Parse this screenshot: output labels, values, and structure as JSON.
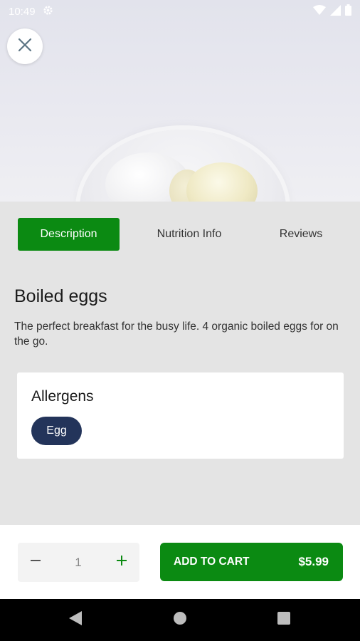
{
  "status_bar": {
    "time": "10:49"
  },
  "tabs": [
    {
      "label": "Description",
      "active": true
    },
    {
      "label": "Nutrition Info",
      "active": false
    },
    {
      "label": "Reviews",
      "active": false
    }
  ],
  "product": {
    "title": "Boiled eggs",
    "description": "The perfect breakfast for the busy life. 4 organic boiled eggs for on the go."
  },
  "allergens": {
    "heading": "Allergens",
    "items": [
      "Egg"
    ]
  },
  "quantity": {
    "value": "1",
    "decrement_icon": "minus-icon",
    "increment_icon": "plus-icon"
  },
  "cart": {
    "label": "ADD TO CART",
    "price": "$5.99"
  },
  "colors": {
    "accent": "#0b8a12",
    "chip": "#23345a",
    "background": "#e4e4e4"
  },
  "icons": {
    "close": "close-icon",
    "settings": "gear-icon",
    "wifi": "wifi-icon",
    "signal": "signal-icon",
    "battery": "battery-icon",
    "nav_back": "back-triangle-icon",
    "nav_home": "home-circle-icon",
    "nav_recents": "recents-square-icon"
  }
}
